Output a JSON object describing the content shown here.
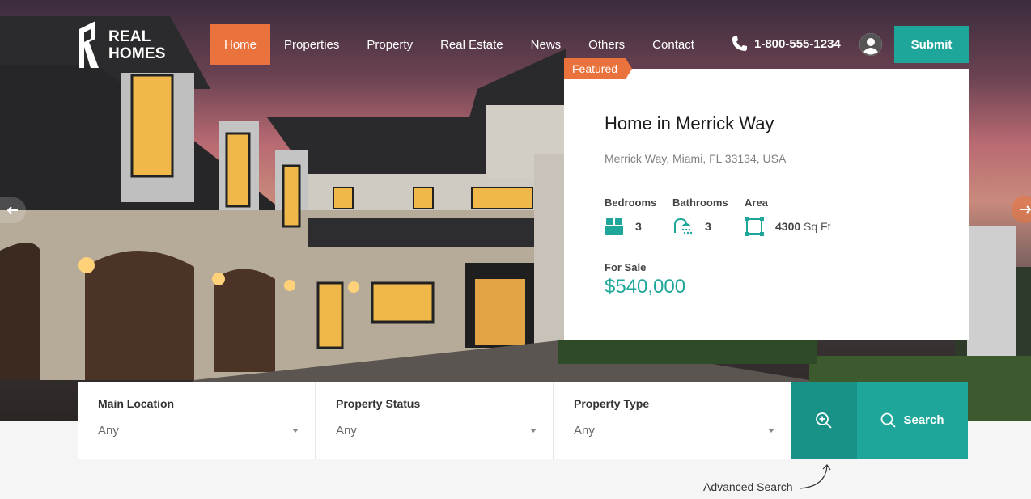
{
  "header": {
    "logo_line1": "REAL",
    "logo_line2": "HOMES",
    "nav": [
      {
        "label": "Home",
        "active": true
      },
      {
        "label": "Properties"
      },
      {
        "label": "Property"
      },
      {
        "label": "Real Estate"
      },
      {
        "label": "News"
      },
      {
        "label": "Others"
      },
      {
        "label": "Contact"
      }
    ],
    "phone": "1-800-555-1234",
    "submit_label": "Submit"
  },
  "featured": {
    "tag": "Featured",
    "title": "Home in Merrick Way",
    "address": "Merrick Way, Miami, FL 33134, USA",
    "bedrooms_label": "Bedrooms",
    "bedrooms": "3",
    "bathrooms_label": "Bathrooms",
    "bathrooms": "3",
    "area_label": "Area",
    "area": "4300",
    "area_unit": "Sq Ft",
    "status": "For Sale",
    "price": "$540,000"
  },
  "search": {
    "fields": [
      {
        "label": "Main Location",
        "value": "Any"
      },
      {
        "label": "Property Status",
        "value": "Any"
      },
      {
        "label": "Property Type",
        "value": "Any"
      }
    ],
    "search_label": "Search",
    "advanced_note": "Advanced Search"
  },
  "colors": {
    "accent_orange": "#ea723d",
    "accent_teal": "#1ea69a",
    "accent_teal_dark": "#189187"
  },
  "icons": [
    "logo-icon",
    "phone-icon",
    "user-icon",
    "bed-icon",
    "shower-icon",
    "area-icon",
    "zoom-plus-icon",
    "search-icon",
    "arrow-left-icon",
    "arrow-right-icon"
  ]
}
